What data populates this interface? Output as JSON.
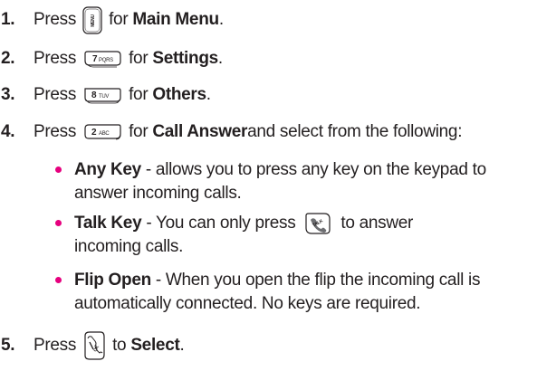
{
  "steps": [
    {
      "num": "1.",
      "before": "Press",
      "after": "for",
      "bold": "Main Menu",
      "end": ".",
      "key": "menu-key-icon"
    },
    {
      "num": "2.",
      "before": "Press",
      "after": "for",
      "bold": "Settings",
      "end": ".",
      "key": "7pqrs-key-icon",
      "key_label": "7PQRS"
    },
    {
      "num": "3.",
      "before": "Press",
      "after": "for",
      "bold": "Others",
      "end": ".",
      "key": "8tuv-key-icon",
      "key_label": "8TUV"
    },
    {
      "num": "4.",
      "before": "Press",
      "after": "for",
      "bold": "Call Answer",
      "end": " and select from the following:",
      "key": "2abc-key-icon",
      "key_label": "2ABC"
    },
    {
      "num": "5.",
      "before": "Press",
      "after": "to",
      "bold": "Select",
      "end": ".",
      "key": "ok-key-icon"
    }
  ],
  "bullets": [
    {
      "bold": "Any Key",
      "line1": " - allows you to press any key on the keypad to",
      "line2": "answer incoming calls."
    },
    {
      "bold": "Talk Key",
      "line1_pre": " - You can only press",
      "line1_post": " to answer",
      "line2": "incoming calls.",
      "key": "talk-key-icon"
    },
    {
      "bold": "Flip Open",
      "line1": " - When you open the flip the incoming call is",
      "line2": "automatically connected. No keys are required."
    }
  ],
  "colors": {
    "bullet": "#e6007e",
    "text": "#231f20"
  }
}
